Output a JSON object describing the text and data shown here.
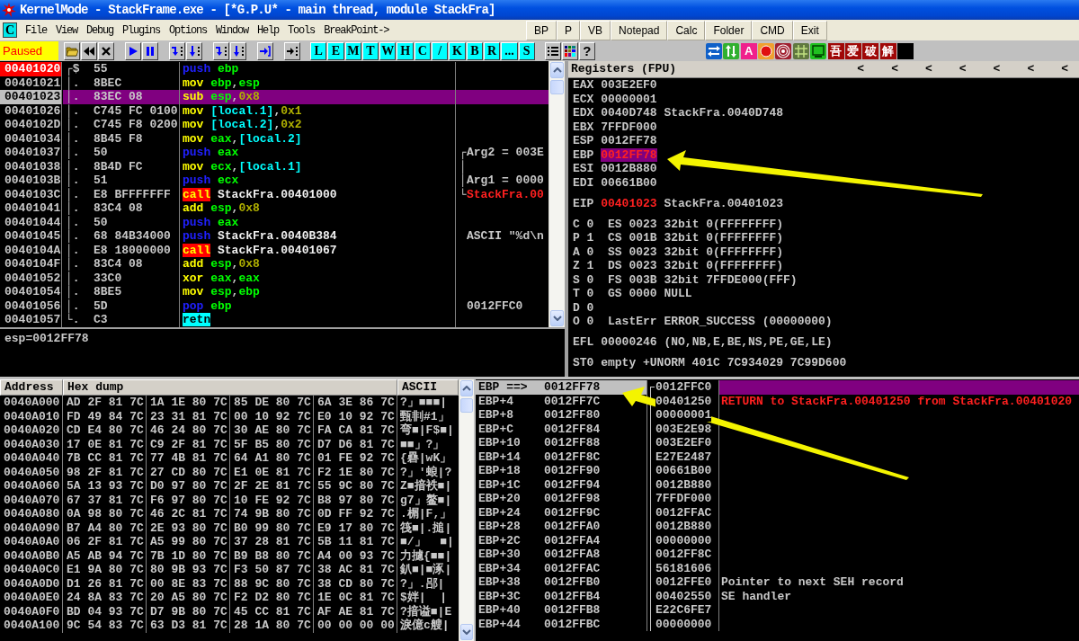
{
  "window": {
    "title": "KernelMode - StackFrame.exe - [*G.P.U* - main thread, module StackFra]"
  },
  "menu_bar": {
    "logo": "C",
    "menus": [
      "File",
      "View",
      "Debug",
      "Plugins",
      "Options",
      "Window",
      "Help",
      "Tools",
      "BreakPoint->"
    ],
    "buttons": [
      "BP",
      "P",
      "VB",
      "Notepad",
      "Calc",
      "Folder",
      "CMD",
      "Exit"
    ]
  },
  "toolbar": {
    "status": "Paused",
    "letter_buttons": [
      "L",
      "E",
      "M",
      "T",
      "W",
      "H",
      "C",
      "/",
      "K",
      "B",
      "R",
      "...",
      "S"
    ],
    "help_button": "?",
    "plugin_buttons": [
      {
        "kind": "swap"
      },
      {
        "kind": "updown"
      },
      {
        "kind": "letter",
        "text": "A",
        "color": "#f0208c"
      },
      {
        "kind": "record"
      },
      {
        "kind": "target"
      },
      {
        "kind": "grid"
      },
      {
        "kind": "window"
      },
      {
        "kind": "letter",
        "text": "吾",
        "color": "#a00808"
      },
      {
        "kind": "letter",
        "text": "爱",
        "color": "#a00808"
      },
      {
        "kind": "letter",
        "text": "破",
        "color": "#a00808"
      },
      {
        "kind": "letter",
        "text": "解",
        "color": "#a00808"
      },
      {
        "kind": "blank"
      }
    ]
  },
  "disassembly": {
    "rows": [
      {
        "address": "00401020",
        "marker": "┌$",
        "hex": "55",
        "tokens": [
          {
            "text": "push",
            "kind": "stack"
          },
          {
            "text": "ebp",
            "kind": "register"
          }
        ],
        "breakpoint": true,
        "selected": false
      },
      {
        "address": "00401021",
        "marker": "│.",
        "hex": "8BEC",
        "tokens": [
          {
            "text": "mov",
            "kind": "data"
          },
          {
            "text": "ebp",
            "kind": "register"
          },
          {
            "text": ",",
            "kind": "punct"
          },
          {
            "text": "esp",
            "kind": "register"
          }
        ],
        "breakpoint": false,
        "selected": false
      },
      {
        "address": "00401023",
        "marker": "│.",
        "hex": "83EC 08",
        "tokens": [
          {
            "text": "sub",
            "kind": "data"
          },
          {
            "text": "esp",
            "kind": "register"
          },
          {
            "text": ",",
            "kind": "punct"
          },
          {
            "text": "0x8",
            "kind": "constant"
          }
        ],
        "breakpoint": false,
        "selected": true
      },
      {
        "address": "00401026",
        "marker": "│.",
        "hex": "C745 FC 0100",
        "tokens": [
          {
            "text": "mov",
            "kind": "data"
          },
          {
            "text": "[local.1]",
            "kind": "memory"
          },
          {
            "text": ",",
            "kind": "punct"
          },
          {
            "text": "0x1",
            "kind": "constant"
          }
        ],
        "breakpoint": false,
        "selected": false
      },
      {
        "address": "0040102D",
        "marker": "│.",
        "hex": "C745 F8 0200",
        "tokens": [
          {
            "text": "mov",
            "kind": "data"
          },
          {
            "text": "[local.2]",
            "kind": "memory"
          },
          {
            "text": ",",
            "kind": "punct"
          },
          {
            "text": "0x2",
            "kind": "constant"
          }
        ],
        "breakpoint": false,
        "selected": false
      },
      {
        "address": "00401034",
        "marker": "│.",
        "hex": "8B45 F8",
        "tokens": [
          {
            "text": "mov",
            "kind": "data"
          },
          {
            "text": "eax",
            "kind": "register"
          },
          {
            "text": ",",
            "kind": "punct"
          },
          {
            "text": "[local.2]",
            "kind": "memory"
          }
        ],
        "breakpoint": false,
        "selected": false
      },
      {
        "address": "00401037",
        "marker": "│.",
        "hex": "50",
        "tokens": [
          {
            "text": "push",
            "kind": "stack"
          },
          {
            "text": "eax",
            "kind": "register"
          }
        ],
        "comment": {
          "bracket": "┌",
          "text": "Arg2 = 003E",
          "highlighted": false
        },
        "breakpoint": false,
        "selected": false
      },
      {
        "address": "00401038",
        "marker": "│.",
        "hex": "8B4D FC",
        "tokens": [
          {
            "text": "mov",
            "kind": "data"
          },
          {
            "text": "ecx",
            "kind": "register"
          },
          {
            "text": ",",
            "kind": "punct"
          },
          {
            "text": "[local.1]",
            "kind": "memory"
          }
        ],
        "comment": {
          "bracket": "│"
        },
        "breakpoint": false,
        "selected": false
      },
      {
        "address": "0040103B",
        "marker": "│.",
        "hex": "51",
        "tokens": [
          {
            "text": "push",
            "kind": "stack"
          },
          {
            "text": "ecx",
            "kind": "register"
          }
        ],
        "comment": {
          "bracket": "│",
          "text": "Arg1 = 0000",
          "highlighted": false
        },
        "breakpoint": false,
        "selected": false
      },
      {
        "address": "0040103C",
        "marker": "│.",
        "hex": "E8 BFFFFFFF",
        "tokens": [
          {
            "text": "call",
            "kind": "call"
          },
          {
            "text": "StackFra.00401000",
            "kind": "symbol"
          }
        ],
        "comment": {
          "bracket": "└",
          "text": "StackFra.00",
          "highlighted": true
        },
        "breakpoint": false,
        "selected": false
      },
      {
        "address": "00401041",
        "marker": "│.",
        "hex": "83C4 08",
        "tokens": [
          {
            "text": "add",
            "kind": "data"
          },
          {
            "text": "esp",
            "kind": "register"
          },
          {
            "text": ",",
            "kind": "punct"
          },
          {
            "text": "0x8",
            "kind": "constant"
          }
        ],
        "breakpoint": false,
        "selected": false
      },
      {
        "address": "00401044",
        "marker": "│.",
        "hex": "50",
        "tokens": [
          {
            "text": "push",
            "kind": "stack"
          },
          {
            "text": "eax",
            "kind": "register"
          }
        ],
        "breakpoint": false,
        "selected": false
      },
      {
        "address": "00401045",
        "marker": "│.",
        "hex": "68 84B34000",
        "tokens": [
          {
            "text": "push",
            "kind": "stack"
          },
          {
            "text": "StackFra.0040B384",
            "kind": "symbol"
          }
        ],
        "comment": {
          "text": "ASCII \"%d\\n",
          "highlighted": false
        },
        "breakpoint": false,
        "selected": false
      },
      {
        "address": "0040104A",
        "marker": "│.",
        "hex": "E8 18000000",
        "tokens": [
          {
            "text": "call",
            "kind": "call"
          },
          {
            "text": "StackFra.00401067",
            "kind": "symbol"
          }
        ],
        "breakpoint": false,
        "selected": false
      },
      {
        "address": "0040104F",
        "marker": "│.",
        "hex": "83C4 08",
        "tokens": [
          {
            "text": "add",
            "kind": "data"
          },
          {
            "text": "esp",
            "kind": "register"
          },
          {
            "text": ",",
            "kind": "punct"
          },
          {
            "text": "0x8",
            "kind": "constant"
          }
        ],
        "breakpoint": false,
        "selected": false
      },
      {
        "address": "00401052",
        "marker": "│.",
        "hex": "33C0",
        "tokens": [
          {
            "text": "xor",
            "kind": "data"
          },
          {
            "text": "eax",
            "kind": "register"
          },
          {
            "text": ",",
            "kind": "punct"
          },
          {
            "text": "eax",
            "kind": "register"
          }
        ],
        "breakpoint": false,
        "selected": false
      },
      {
        "address": "00401054",
        "marker": "│.",
        "hex": "8BE5",
        "tokens": [
          {
            "text": "mov",
            "kind": "data"
          },
          {
            "text": "esp",
            "kind": "register"
          },
          {
            "text": ",",
            "kind": "punct"
          },
          {
            "text": "ebp",
            "kind": "register"
          }
        ],
        "breakpoint": false,
        "selected": false
      },
      {
        "address": "00401056",
        "marker": "│.",
        "hex": "5D",
        "tokens": [
          {
            "text": "pop",
            "kind": "stack"
          },
          {
            "text": "ebp",
            "kind": "register"
          }
        ],
        "comment": {
          "text": "0012FFC0",
          "highlighted": false
        },
        "breakpoint": false,
        "selected": false
      },
      {
        "address": "00401057",
        "marker": "└.",
        "hex": "C3",
        "tokens": [
          {
            "text": "retn",
            "kind": "return"
          }
        ],
        "breakpoint": false,
        "selected": false
      }
    ]
  },
  "info": {
    "text": "esp=0012FF78"
  },
  "registers": {
    "title": "Registers (FPU)",
    "view_buttons": [
      "<",
      "<",
      "<",
      "<",
      "<",
      "<",
      "<"
    ],
    "groups": [
      {
        "kind": "general",
        "rows": [
          {
            "name": "EAX",
            "value": "003E2EF0",
            "modified": false,
            "selected": false
          },
          {
            "name": "ECX",
            "value": "00000001",
            "modified": false,
            "selected": false
          },
          {
            "name": "EDX",
            "value": "0040D748",
            "note": "StackFra.0040D748",
            "modified": false,
            "selected": false
          },
          {
            "name": "EBX",
            "value": "7FFDF000",
            "modified": false,
            "selected": false
          },
          {
            "name": "ESP",
            "value": "0012FF78",
            "modified": false,
            "selected": false
          },
          {
            "name": "EBP",
            "value": "0012FF78",
            "modified": true,
            "selected": true
          },
          {
            "name": "ESI",
            "value": "0012B880",
            "modified": false,
            "selected": false
          },
          {
            "name": "EDI",
            "value": "00661B00",
            "modified": false,
            "selected": false
          }
        ]
      },
      {
        "kind": "general",
        "rows": [
          {
            "name": "EIP",
            "value": "00401023",
            "note": "StackFra.00401023",
            "modified": true,
            "selected": false
          }
        ]
      },
      {
        "kind": "flags",
        "rows": [
          {
            "name": "C",
            "value": "0",
            "note": "ES 0023 32bit 0(FFFFFFFF)",
            "modified": false,
            "selected": false
          },
          {
            "name": "P",
            "value": "1",
            "note": "CS 001B 32bit 0(FFFFFFFF)",
            "modified": false,
            "selected": false
          },
          {
            "name": "A",
            "value": "0",
            "note": "SS 0023 32bit 0(FFFFFFFF)",
            "modified": false,
            "selected": false
          },
          {
            "name": "Z",
            "value": "1",
            "note": "DS 0023 32bit 0(FFFFFFFF)",
            "modified": false,
            "selected": false
          },
          {
            "name": "S",
            "value": "0",
            "note": "FS 003B 32bit 7FFDE000(FFF)",
            "modified": false,
            "selected": false
          },
          {
            "name": "T",
            "value": "0",
            "note": "GS 0000 NULL",
            "modified": false,
            "selected": false
          },
          {
            "name": "D",
            "value": "0",
            "modified": false,
            "selected": false
          },
          {
            "name": "O",
            "value": "0",
            "note": "LastErr ERROR_SUCCESS (00000000)",
            "modified": false,
            "selected": false
          }
        ]
      },
      {
        "kind": "general",
        "rows": [
          {
            "name": "EFL",
            "value": "00000246",
            "note": "(NO,NB,E,BE,NS,PE,GE,LE)",
            "modified": false,
            "selected": false
          }
        ]
      },
      {
        "kind": "fpu",
        "rows": [
          {
            "name": "ST0",
            "value": "empty",
            "note": "+UNORM 401C 7C934029 7C99D600",
            "modified": false,
            "selected": false
          }
        ]
      }
    ]
  },
  "hex_dump": {
    "columns": [
      "Address",
      "Hex dump",
      "ASCII"
    ],
    "rows": [
      {
        "address": "0040A000",
        "groups": [
          "AD 2F 81 7C",
          "1A 1E 80 7C",
          "85 DE 80 7C",
          "6A 3E 86 7C"
        ],
        "ascii": "?」■■■|"
      },
      {
        "address": "0040A010",
        "groups": [
          "FD 49 84 7C",
          "23 31 81 7C",
          "00 10 92 7C",
          "E0 10 92 7C"
        ],
        "ascii": "甄剕#1」"
      },
      {
        "address": "0040A020",
        "groups": [
          "CD E4 80 7C",
          "46 24 80 7C",
          "30 AE 80 7C",
          "FA CA 81 7C"
        ],
        "ascii": "弯■|F$■|"
      },
      {
        "address": "0040A030",
        "groups": [
          "17 0E 81 7C",
          "C9 2F 81 7C",
          "5F B5 80 7C",
          "D7 D6 81 7C"
        ],
        "ascii": "■■」?」"
      },
      {
        "address": "0040A040",
        "groups": [
          "7B CC 81 7C",
          "77 4B 81 7C",
          "64 A1 80 7C",
          "01 FE 92 7C"
        ],
        "ascii": "{礨|wK」"
      },
      {
        "address": "0040A050",
        "groups": [
          "98 2F 81 7C",
          "27 CD 80 7C",
          "E1 0E 81 7C",
          "F2 1E 80 7C"
        ],
        "ascii": "?」'蜋|?"
      },
      {
        "address": "0040A060",
        "groups": [
          "5A 13 93 7C",
          "D0 97 80 7C",
          "2F 2E 81 7C",
          "55 9C 80 7C"
        ],
        "ascii": "Z■揞袟■|"
      },
      {
        "address": "0040A070",
        "groups": [
          "67 37 81 7C",
          "F6 97 80 7C",
          "10 FE 92 7C",
          "B8 97 80 7C"
        ],
        "ascii": "g7」鳌■|"
      },
      {
        "address": "0040A080",
        "groups": [
          "0A 98 80 7C",
          "46 2C 81 7C",
          "74 9B 80 7C",
          "0D FF 92 7C"
        ],
        "ascii": ".榍|F,」"
      },
      {
        "address": "0040A090",
        "groups": [
          "B7 A4 80 7C",
          "2E 93 80 7C",
          "B0 99 80 7C",
          "E9 17 80 7C"
        ],
        "ascii": "筏■|.搥|"
      },
      {
        "address": "0040A0A0",
        "groups": [
          "06 2F 81 7C",
          "A5 99 80 7C",
          "37 28 81 7C",
          "5B 11 81 7C"
        ],
        "ascii": "■/」  ■|"
      },
      {
        "address": "0040A0B0",
        "groups": [
          "A5 AB 94 7C",
          "7B 1D 80 7C",
          "B9 B8 80 7C",
          "A4 00 93 7C"
        ],
        "ascii": "力攄{■■|"
      },
      {
        "address": "0040A0C0",
        "groups": [
          "E1 9A 80 7C",
          "80 9B 93 7C",
          "F3 50 87 7C",
          "38 AC 81 7C"
        ],
        "ascii": "釟■|■涿|"
      },
      {
        "address": "0040A0D0",
        "groups": [
          "D1 26 81 7C",
          "00 8E 83 7C",
          "88 9C 80 7C",
          "38 CD 80 7C"
        ],
        "ascii": "?」.郘|"
      },
      {
        "address": "0040A0E0",
        "groups": [
          "24 8A 83 7C",
          "20 A5 80 7C",
          "F2 D2 80 7C",
          "1E 0C 81 7C"
        ],
        "ascii": "$姅|  |"
      },
      {
        "address": "0040A0F0",
        "groups": [
          "BD 04 93 7C",
          "D7 9B 80 7C",
          "45 CC 81 7C",
          "AF AE 81 7C"
        ],
        "ascii": "?揞谥■|E"
      },
      {
        "address": "0040A100",
        "groups": [
          "9C 54 83 7C",
          "63 D3 81 7C",
          "28 1A 80 7C",
          "00 00 00 00"
        ],
        "ascii": "淚億c艘|"
      }
    ]
  },
  "stack": {
    "rows": [
      {
        "label": "EBP ==>",
        "address": "0012FF78",
        "value": "0012FFC0",
        "selected": true
      },
      {
        "label": "EBP+4",
        "address": "0012FF7C",
        "value": "00401250",
        "comment": {
          "text": "RETURN to StackFra.00401250 from StackFra.00401020",
          "highlighted": true
        },
        "selected": false
      },
      {
        "label": "EBP+8",
        "address": "0012FF80",
        "value": "00000001",
        "selected": false
      },
      {
        "label": "EBP+C",
        "address": "0012FF84",
        "value": "003E2E98",
        "selected": false
      },
      {
        "label": "EBP+10",
        "address": "0012FF88",
        "value": "003E2EF0",
        "selected": false
      },
      {
        "label": "EBP+14",
        "address": "0012FF8C",
        "value": "E27E2487",
        "selected": false
      },
      {
        "label": "EBP+18",
        "address": "0012FF90",
        "value": "00661B00",
        "selected": false
      },
      {
        "label": "EBP+1C",
        "address": "0012FF94",
        "value": "0012B880",
        "selected": false
      },
      {
        "label": "EBP+20",
        "address": "0012FF98",
        "value": "7FFDF000",
        "selected": false
      },
      {
        "label": "EBP+24",
        "address": "0012FF9C",
        "value": "0012FFAC",
        "selected": false
      },
      {
        "label": "EBP+28",
        "address": "0012FFA0",
        "value": "0012B880",
        "selected": false
      },
      {
        "label": "EBP+2C",
        "address": "0012FFA4",
        "value": "00000000",
        "selected": false
      },
      {
        "label": "EBP+30",
        "address": "0012FFA8",
        "value": "0012FF8C",
        "selected": false
      },
      {
        "label": "EBP+34",
        "address": "0012FFAC",
        "value": "56181606",
        "selected": false
      },
      {
        "label": "EBP+38",
        "address": "0012FFB0",
        "value": "0012FFE0",
        "comment": {
          "text": "Pointer to next SEH record",
          "highlighted": false
        },
        "selected": false
      },
      {
        "label": "EBP+3C",
        "address": "0012FFB4",
        "value": "00402550",
        "comment": {
          "text": "SE handler",
          "highlighted": false
        },
        "selected": false
      },
      {
        "label": "EBP+40",
        "address": "0012FFB8",
        "value": "E22C6FE7",
        "selected": false
      },
      {
        "label": "EBP+44",
        "address": "0012FFBC",
        "value": "00000000",
        "selected": false
      }
    ]
  }
}
